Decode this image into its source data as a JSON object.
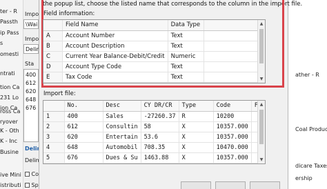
{
  "left_panel": {
    "items": [
      "ter - R",
      "Passth",
      "ip Pass",
      "s",
      "omesti",
      "ntrati",
      "tion Ca",
      "231 Lo",
      "ion Ca",
      "ross Ca",
      "ryover",
      "K - Oth",
      "K - Inc",
      "Busine",
      "ive Mini",
      "istributi"
    ]
  },
  "bg_panel": {
    "labels": [
      "Impo",
      "Impo",
      "Sta",
      "Delimi",
      "Delimi"
    ],
    "path_value": "\\Wai",
    "format_value": "Delim",
    "data_lines": [
      "400",
      "612",
      "620",
      "648",
      "676"
    ],
    "checkbox_labels": [
      "Co",
      "Spa"
    ]
  },
  "right_panel": {
    "items": [
      "ather - R",
      "Coal Product",
      "dicare Taxes I",
      "ership"
    ]
  },
  "dialog": {
    "hint": "the popup list, choose the listed name that corresponds to the column in the import file.",
    "field_info": {
      "label": "Field information:",
      "columns": [
        "",
        "Field Name",
        "Data Type"
      ],
      "rows": [
        {
          "id": "A",
          "name": "Account Number",
          "type": "Text"
        },
        {
          "id": "B",
          "name": "Account Description",
          "type": "Text"
        },
        {
          "id": "C",
          "name": "Current Year Balance-Debit/Credit",
          "type": "Numeric"
        },
        {
          "id": "D",
          "name": "Account Type Code",
          "type": "Text"
        },
        {
          "id": "E",
          "name": "Tax Code",
          "type": "Text"
        }
      ]
    },
    "import_file": {
      "label": "Import file:",
      "columns": [
        "",
        "No.",
        "Desc",
        "CY DR/CR",
        "Type",
        "Code",
        "F"
      ],
      "rows": [
        {
          "n": "1",
          "no": "400",
          "desc": "Sales",
          "cy": "-27260.37",
          "type": "R",
          "code": "10200"
        },
        {
          "n": "2",
          "no": "612",
          "desc": "Consultin",
          "cy": "58",
          "type": "X",
          "code": "10357.000"
        },
        {
          "n": "3",
          "no": "620",
          "desc": "Entertain",
          "cy": "53.6",
          "type": "X",
          "code": "10357.000"
        },
        {
          "n": "4",
          "no": "648",
          "desc": "Automobil",
          "cy": "708.35",
          "type": "X",
          "code": "10470.000"
        },
        {
          "n": "5",
          "no": "676",
          "desc": "Dues & Su",
          "cy": "1463.88",
          "type": "X",
          "code": "10357.000"
        }
      ]
    }
  },
  "colors": {
    "highlight_outline": "#d9434b",
    "dialog_bg": "#f0f0f0",
    "grid_border": "#9a9a9a"
  }
}
